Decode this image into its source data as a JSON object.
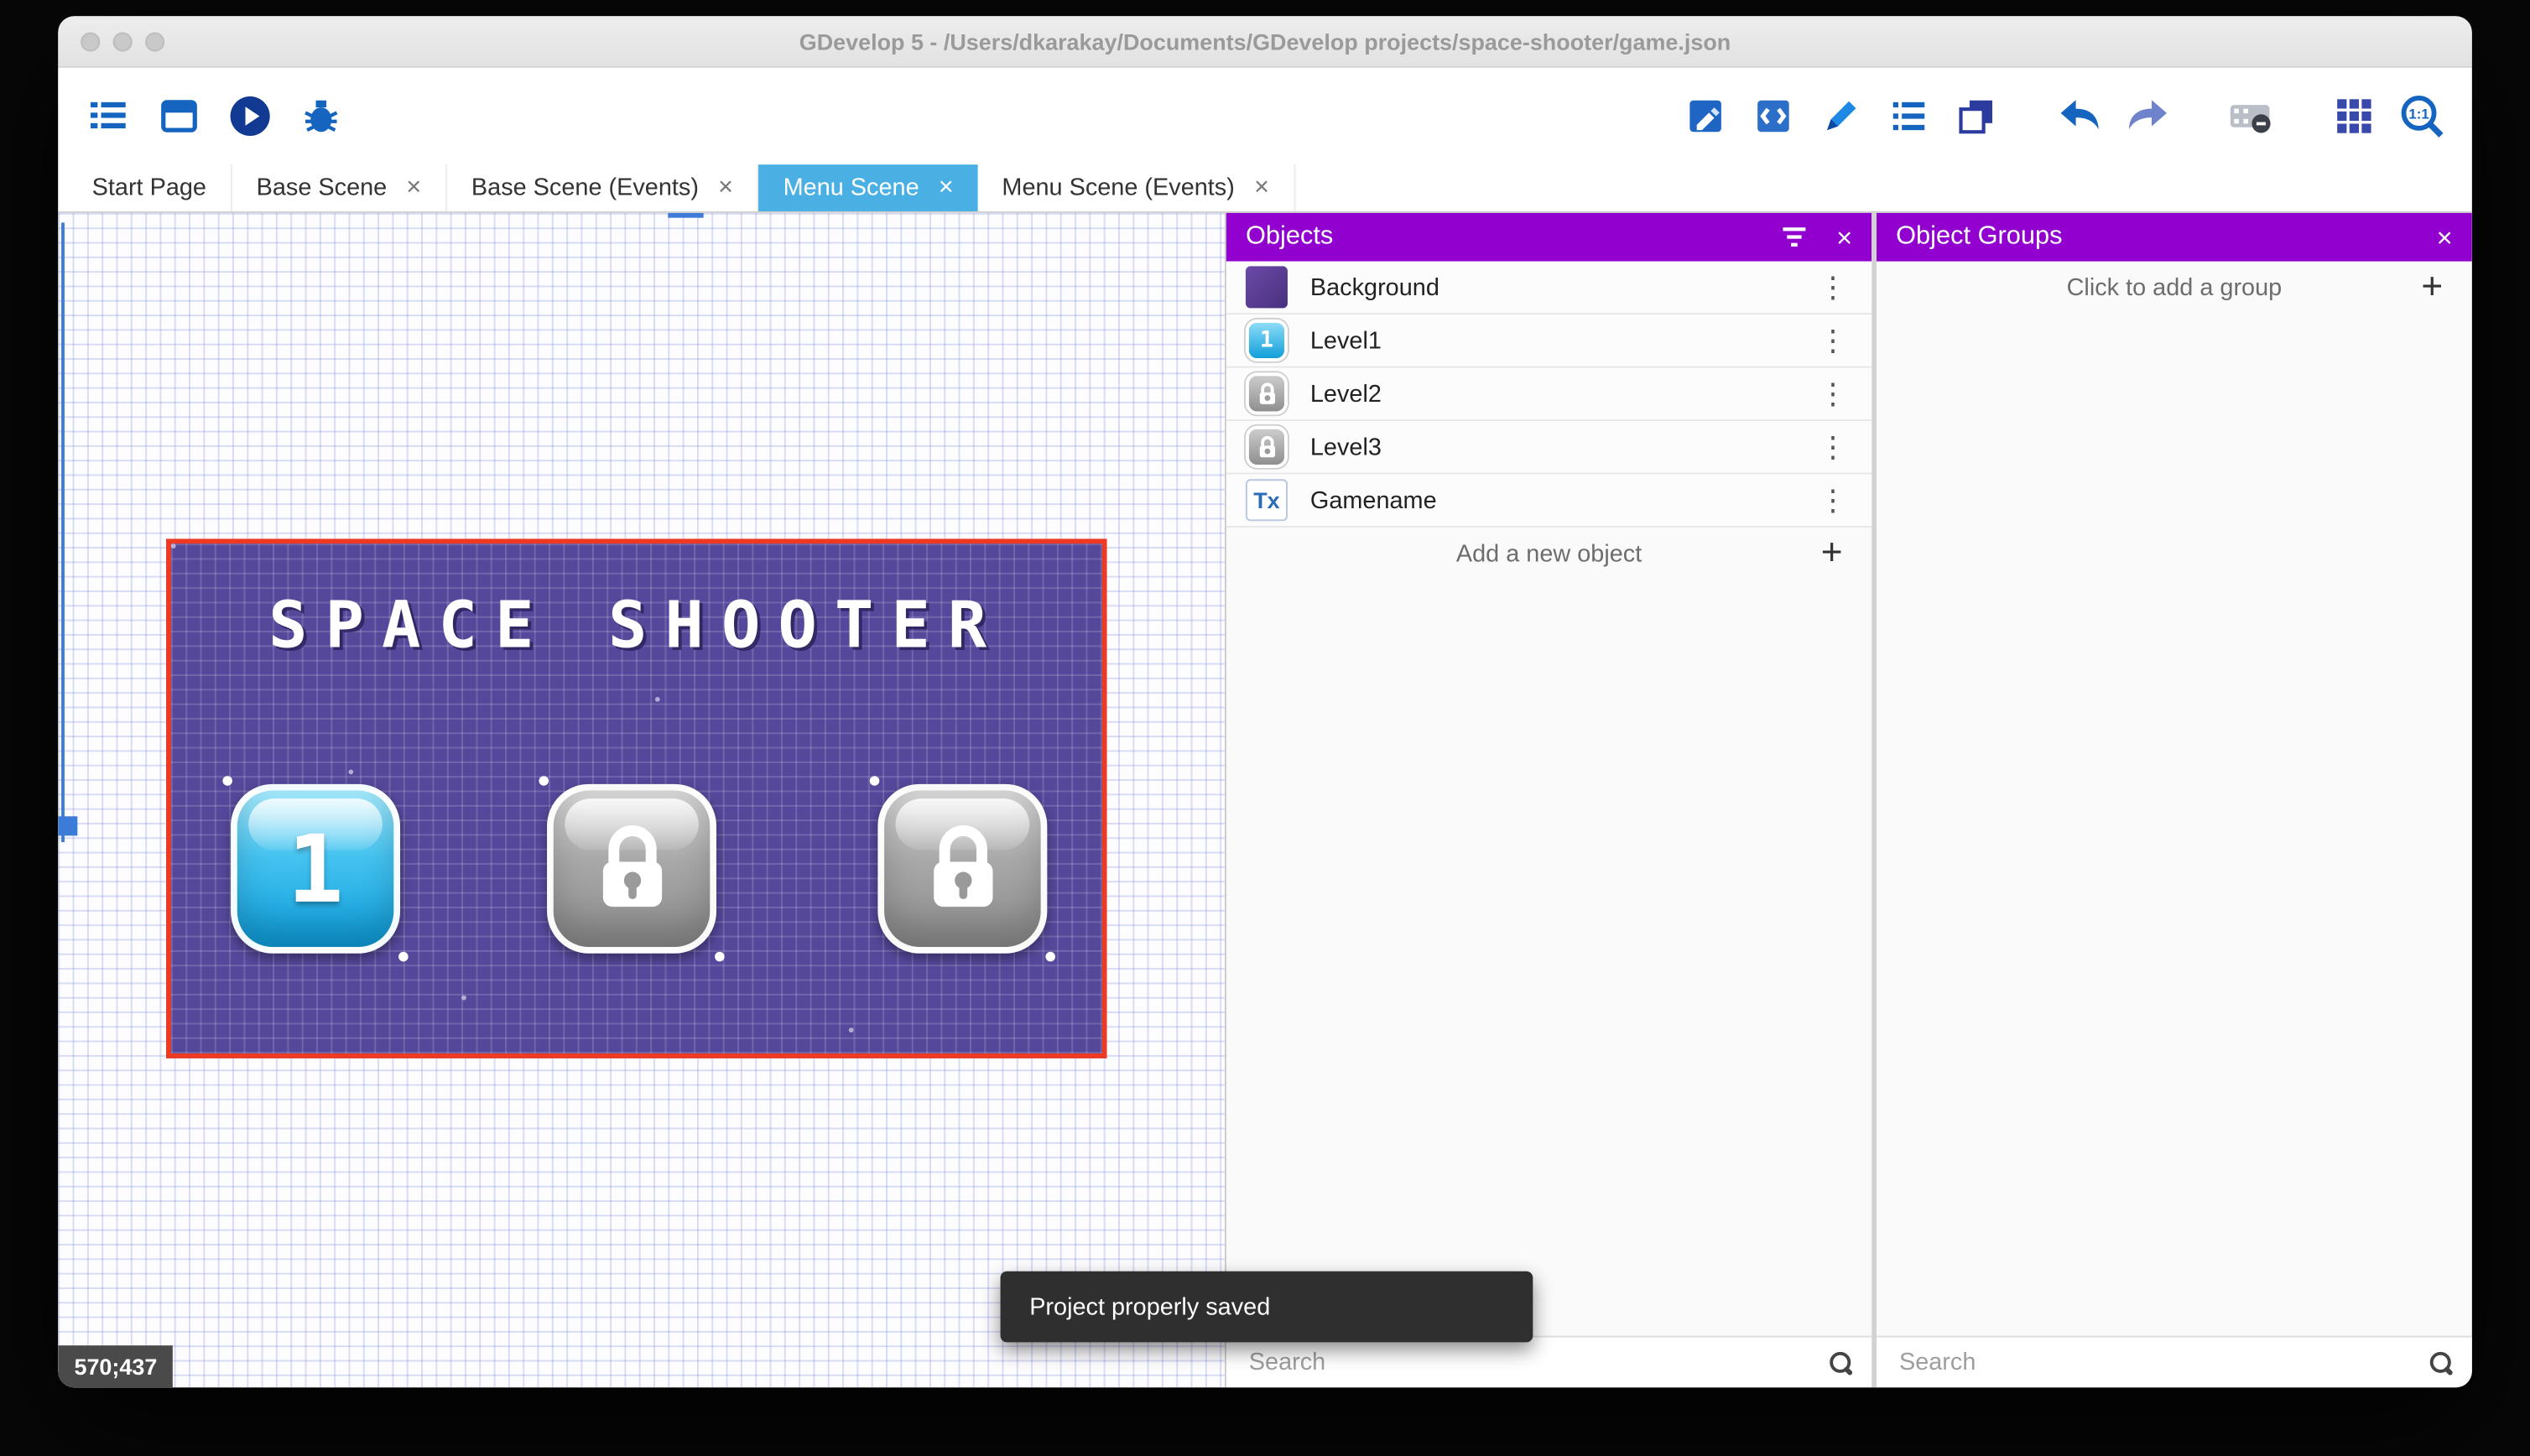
{
  "titlebar": {
    "title": "GDevelop 5 - /Users/dkarakay/Documents/GDevelop projects/space-shooter/game.json"
  },
  "toolbar": {
    "left_icons": [
      "project-manager-icon",
      "scene-editor-icon",
      "start-preview-icon",
      "debug-icon"
    ],
    "right_icons": [
      "objects-editor-icon",
      "object-groups-editor-icon",
      "properties-icon",
      "instances-list-icon",
      "layers-icon",
      "undo-icon",
      "redo-icon",
      "capture-icon",
      "grid-icon",
      "zoom-icon"
    ],
    "zoom_label": "1:1"
  },
  "tabs": {
    "items": [
      {
        "label": "Start Page",
        "close": ""
      },
      {
        "label": "Base Scene",
        "close": "×"
      },
      {
        "label": "Base Scene (Events)",
        "close": "×"
      },
      {
        "label": "Menu Scene",
        "close": "×"
      },
      {
        "label": "Menu Scene (Events)",
        "close": "×"
      }
    ]
  },
  "scene": {
    "title_text": "SPACE SHOOTER",
    "buttons": [
      {
        "label": "1",
        "state": "unlocked"
      },
      {
        "label": "",
        "state": "locked"
      },
      {
        "label": "",
        "state": "locked"
      }
    ],
    "coordinates": "570;437"
  },
  "objects_panel": {
    "header": "Objects",
    "close": "×",
    "rows": [
      {
        "name": "Background",
        "icon": "background-swatch",
        "menu": "⋮",
        "icon_text": ""
      },
      {
        "name": "Level1",
        "icon": "level1-thumbnail",
        "menu": "⋮",
        "icon_text": "1"
      },
      {
        "name": "Level2",
        "icon": "locked-thumbnail",
        "menu": "⋮",
        "icon_text": ""
      },
      {
        "name": "Level3",
        "icon": "locked-thumbnail",
        "menu": "⋮",
        "icon_text": ""
      },
      {
        "name": "Gamename",
        "icon": "text-object-thumbnail",
        "menu": "⋮",
        "icon_text": "Tx"
      }
    ],
    "add_label": "Add a new object",
    "add_plus": "+",
    "search_placeholder": "Search"
  },
  "groups_panel": {
    "header": "Object Groups",
    "close": "×",
    "add_label": "Click to add a group",
    "add_plus": "+",
    "search_placeholder": "Search"
  },
  "snackbar": {
    "message": "Project properly saved"
  },
  "colors": {
    "panel_header_purple": "#9100ce",
    "active_tab_blue": "#4ab0e4",
    "selection_red": "#ee3a22",
    "scene_purple": "#55489b"
  }
}
